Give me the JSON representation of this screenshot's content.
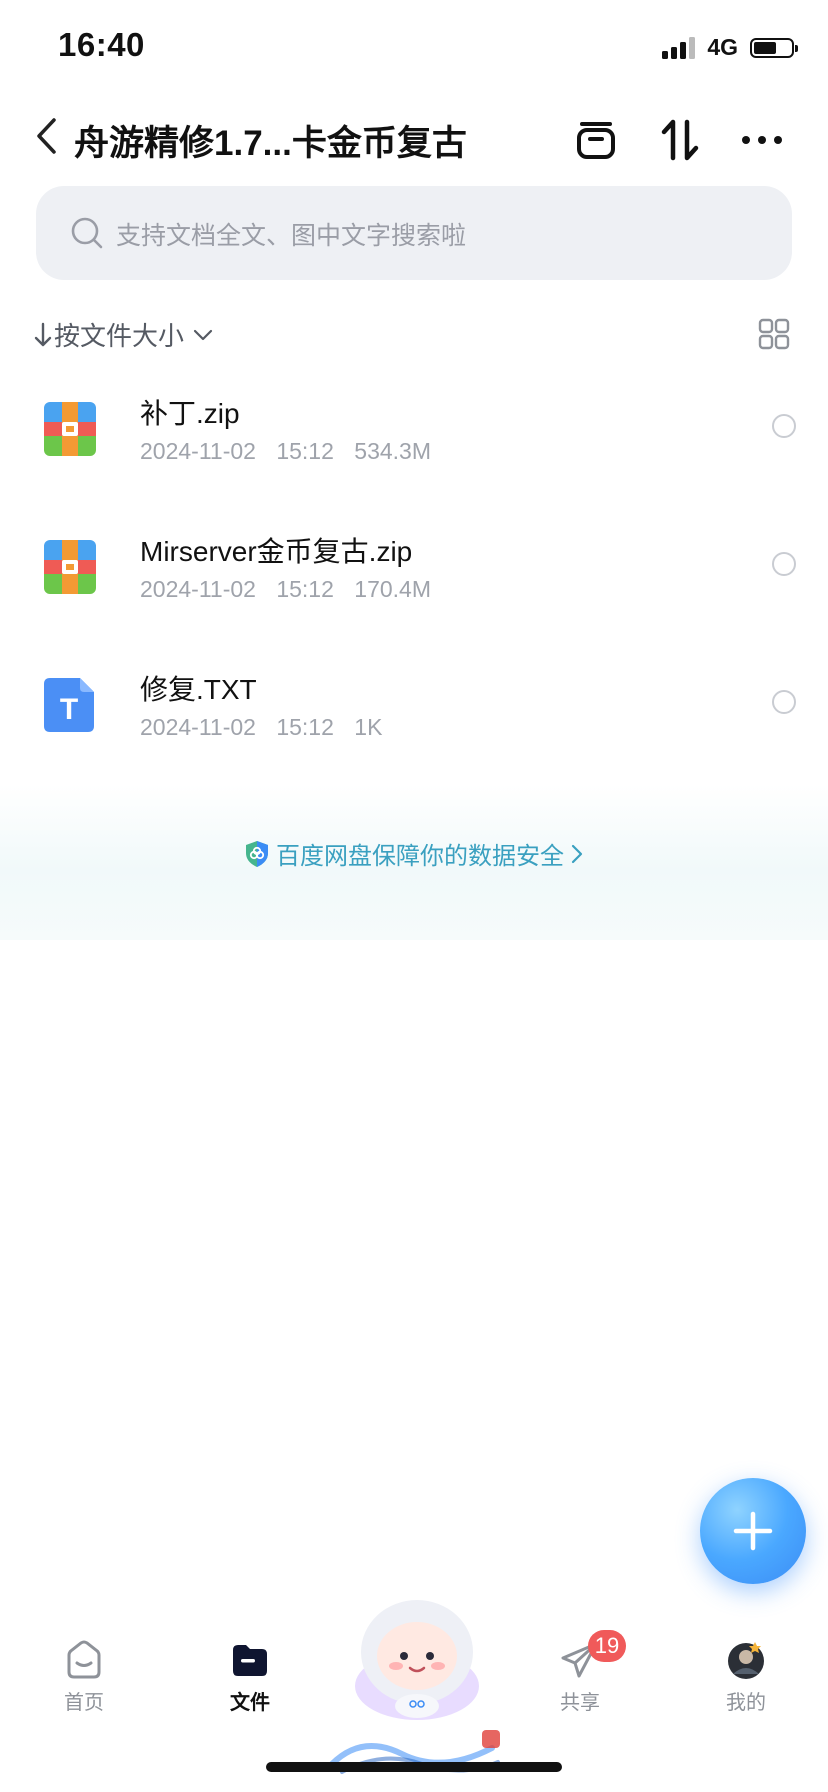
{
  "status_bar": {
    "time": "16:40",
    "network": "4G"
  },
  "header": {
    "title": "舟游精修1.7...卡金币复古"
  },
  "search": {
    "placeholder": "支持文档全文、图中文字搜索啦"
  },
  "sort": {
    "label": "按文件大小"
  },
  "files": [
    {
      "name": "补丁.zip",
      "date": "2024-11-02 15:12",
      "size": "534.3M",
      "type": "zip-icon"
    },
    {
      "name": "Mirserver金币复古.zip",
      "date": "2024-11-02 15:12",
      "size": "170.4M",
      "type": "zip-icon"
    },
    {
      "name": "修复.TXT",
      "date": "2024-11-02 15:12",
      "size": "1K",
      "type": "txt-icon",
      "glyph": "T"
    }
  ],
  "banner": {
    "text": "百度网盘保障你的数据安全"
  },
  "tabs": [
    {
      "label": "首页"
    },
    {
      "label": "文件"
    },
    {
      "label": "共享",
      "badge": "19"
    },
    {
      "label": "我的"
    }
  ],
  "colors": {
    "accent": "#3b8cf5",
    "badge": "#f05a5a",
    "banner_text": "#3aa0c0"
  }
}
